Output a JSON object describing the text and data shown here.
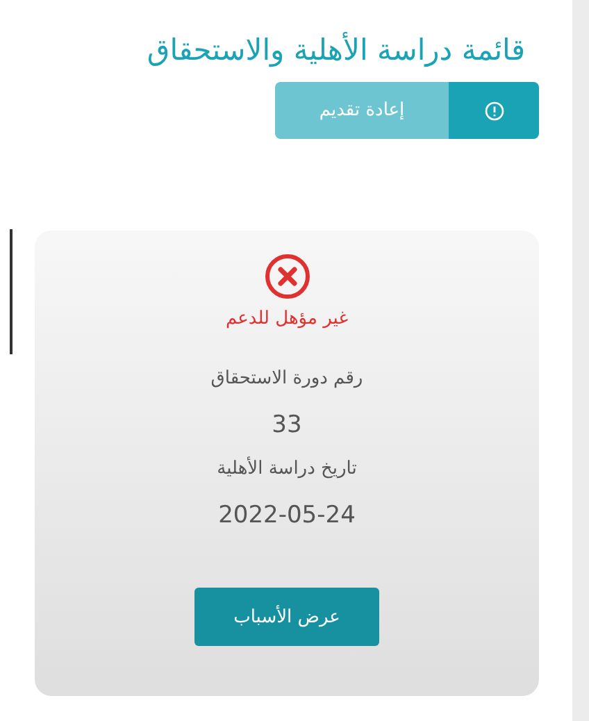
{
  "title": "قائمة دراسة الأهلية والاستحقاق",
  "resubmit_button": {
    "label": "إعادة تقديم",
    "disabled": true
  },
  "result": {
    "eligible": false,
    "status_label": "غير مؤهل للدعم",
    "fields": [
      {
        "label": "رقم دورة الاستحقاق",
        "value": "33"
      },
      {
        "label": "تاريخ دراسة الأهلية",
        "value": "2022-05-24"
      }
    ],
    "button": "عرض الأسباب"
  }
}
